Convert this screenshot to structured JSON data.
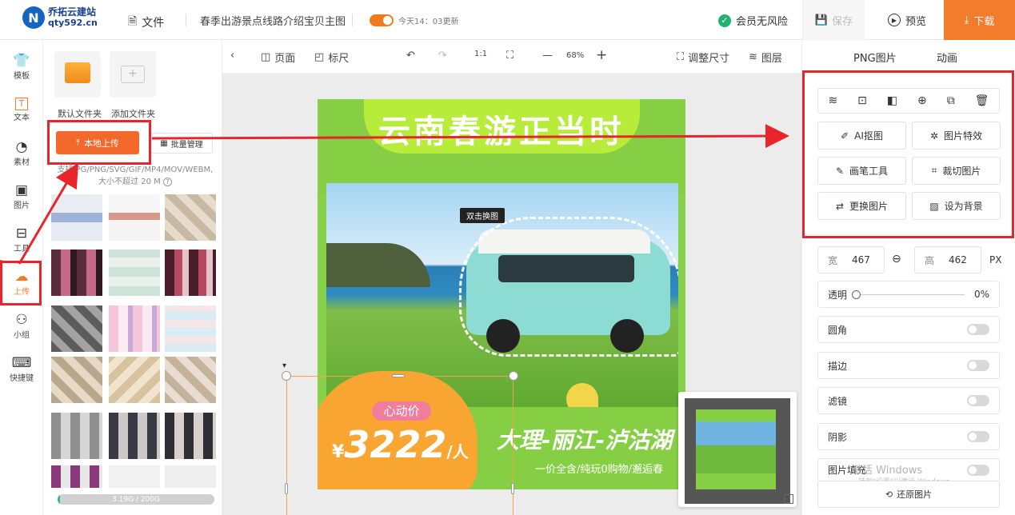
{
  "header": {
    "logo_name": "乔拓云建站",
    "logo_domain": "qty592.cn",
    "file_label": "文件",
    "doc_title": "春季出游景点线路介绍宝贝主图",
    "update_time": "今天14：03更新",
    "member_status": "会员无风险",
    "save_label": "保存",
    "preview_label": "预览",
    "download_label": "下载"
  },
  "nav": {
    "items": [
      {
        "label": "模板",
        "icon": "template-icon"
      },
      {
        "label": "文本",
        "icon": "text-icon"
      },
      {
        "label": "素材",
        "icon": "material-icon"
      },
      {
        "label": "图片",
        "icon": "image-icon"
      },
      {
        "label": "工具",
        "icon": "toolbox-icon"
      },
      {
        "label": "上传",
        "icon": "upload-cloud-icon"
      },
      {
        "label": "小组",
        "icon": "group-icon"
      },
      {
        "label": "快捷键",
        "icon": "keyboard-icon"
      }
    ],
    "active": "上传"
  },
  "upload_panel": {
    "default_folder": "默认文件夹",
    "add_folder": "添加文件夹",
    "local_upload": "本地上传",
    "batch_manage": "批量管理",
    "hint_line1": "支持JPG/PNG/SVG/GIF/MP4/MOV/WEBM,",
    "hint_line2": "大小不超过 20 M",
    "storage": "3.19G / 200G",
    "storage_used_fraction": 0.016
  },
  "canvas_toolbar": {
    "page": "页面",
    "ruler": "标尺",
    "ratio": "1:1",
    "zoom": "68%",
    "resize": "调整尺寸",
    "layers": "图层"
  },
  "poster": {
    "title": "云南春游正当时",
    "double_click_hint": "双击换图",
    "badge": "心动价",
    "currency": "¥",
    "price": "3222",
    "price_unit": "/人",
    "route": "大理-丽江-泸沽湖",
    "subline": "一价全含/纯玩0购物/邂逅春"
  },
  "right_panel": {
    "tab_png": "PNG图片",
    "tab_anim": "动画",
    "toolbar_icons": [
      "align-icon",
      "crop-frame-icon",
      "flip-icon",
      "lock-icon",
      "copy-icon",
      "delete-icon"
    ],
    "ai_cutout": "AI抠图",
    "image_effects": "图片特效",
    "brush_tool": "画笔工具",
    "crop_image": "裁切图片",
    "replace_image": "更换图片",
    "set_background": "设为背景",
    "width_label": "宽",
    "width_value": "467",
    "height_label": "高",
    "height_value": "462",
    "unit": "PX",
    "opacity_label": "透明",
    "opacity_value": "0%",
    "props": [
      "圆角",
      "描边",
      "滤镜",
      "阴影",
      "图片填充"
    ],
    "restore": "还原图片",
    "watermark_title": "激活 Windows",
    "watermark_sub": "转到\"设置\"以激活 Windows。"
  },
  "colors": {
    "accent": "#f27c2b",
    "highlight": "#e8252b",
    "poster_green": "#88d14a",
    "poster_orange": "#f9a532"
  }
}
